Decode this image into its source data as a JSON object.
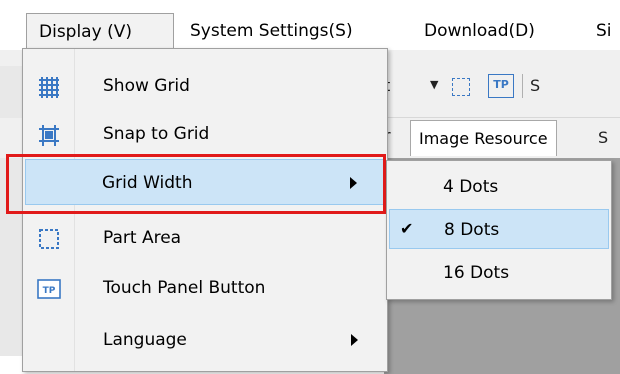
{
  "menubar": {
    "items": [
      "Display (V)",
      "System Settings(S)",
      "Download(D)",
      "Si"
    ]
  },
  "toolbar": {
    "fragment_left": "t",
    "fragment_right": "S",
    "tp_label": "TP"
  },
  "tabs": {
    "fragment_left": "r",
    "image_resource": "Image Resource",
    "fragment_right": "S"
  },
  "display_menu": {
    "items": [
      {
        "label": "Show Grid",
        "icon": "grid-icon"
      },
      {
        "label": "Snap to Grid",
        "icon": "snap-grid-icon"
      },
      {
        "label": "Grid Width",
        "icon": "",
        "has_submenu": true,
        "highlighted": true
      },
      {
        "label": "Part Area",
        "icon": "part-area-icon"
      },
      {
        "label": "Touch Panel Button",
        "icon": "touch-panel-icon",
        "icon_text": "TP"
      },
      {
        "label": "Language",
        "icon": "",
        "has_submenu": true
      }
    ]
  },
  "grid_width_submenu": {
    "items": [
      {
        "label": "4 Dots",
        "checked": false
      },
      {
        "label": "8 Dots",
        "checked": true
      },
      {
        "label": "16 Dots",
        "checked": false
      }
    ],
    "check_glyph": "✔"
  },
  "colors": {
    "highlight": "#cce4f7",
    "highlight_border": "#99c9ef",
    "annotation_red": "#e11a1a",
    "icon_blue": "#3a78c4"
  }
}
